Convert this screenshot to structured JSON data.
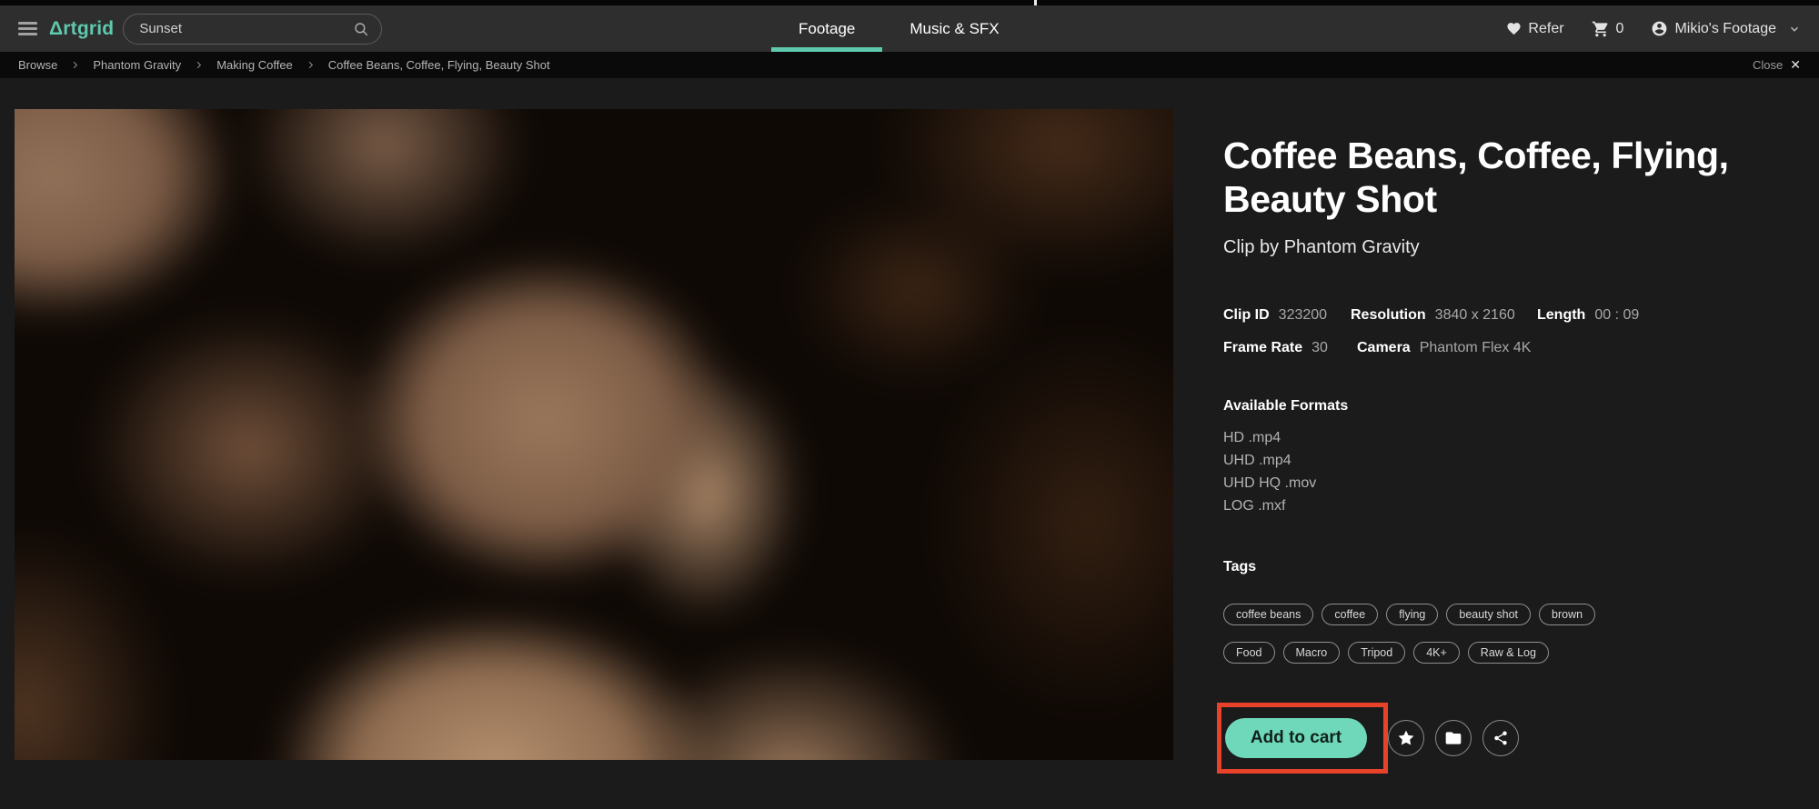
{
  "colors": {
    "accent_teal": "#5fc9ad",
    "button_teal": "#70d8ba",
    "highlight_red": "#e8432a",
    "navbar_bg": "#2e2e2e",
    "page_bg": "#1b1b1b"
  },
  "navbar": {
    "logo": "Δrtgrid",
    "search": {
      "value": "Sunset"
    },
    "tabs": [
      {
        "label": "Footage",
        "active": true
      },
      {
        "label": "Music & SFX",
        "active": false
      }
    ],
    "refer_label": "Refer",
    "cart_count": "0",
    "account_label": "Mikio's Footage"
  },
  "breadcrumb": {
    "items": [
      "Browse",
      "Phantom Gravity",
      "Making Coffee",
      "Coffee Beans, Coffee, Flying, Beauty Shot"
    ],
    "close_label": "Close",
    "close_x": "✕"
  },
  "clip": {
    "title": "Coffee Beans, Coffee, Flying, Beauty Shot",
    "byline": "Clip by Phantom Gravity",
    "meta": [
      {
        "label": "Clip ID",
        "value": "323200"
      },
      {
        "label": "Resolution",
        "value": "3840 x 2160"
      },
      {
        "label": "Length",
        "value": "00 : 09"
      },
      {
        "label": "Frame Rate",
        "value": "30"
      },
      {
        "label": "Camera",
        "value": "Phantom Flex 4K"
      }
    ],
    "formats_heading": "Available Formats",
    "formats": [
      "HD .mp4",
      "UHD .mp4",
      "UHD HQ .mov",
      "LOG .mxf"
    ],
    "tags_heading": "Tags",
    "tags": [
      "coffee beans",
      "coffee",
      "flying",
      "beauty shot",
      "brown",
      "Food",
      "Macro",
      "Tripod",
      "4K+",
      "Raw & Log"
    ],
    "add_to_cart_label": "Add to cart"
  },
  "icons": {
    "navbar": [
      "hamburger-icon",
      "search-icon",
      "heart-icon",
      "cart-icon",
      "account-icon",
      "chevron-down-icon"
    ],
    "breadcrumb": [
      "chevron-right-icon",
      "close-icon"
    ],
    "actions": [
      "star-icon",
      "folder-icon",
      "share-icon"
    ]
  }
}
